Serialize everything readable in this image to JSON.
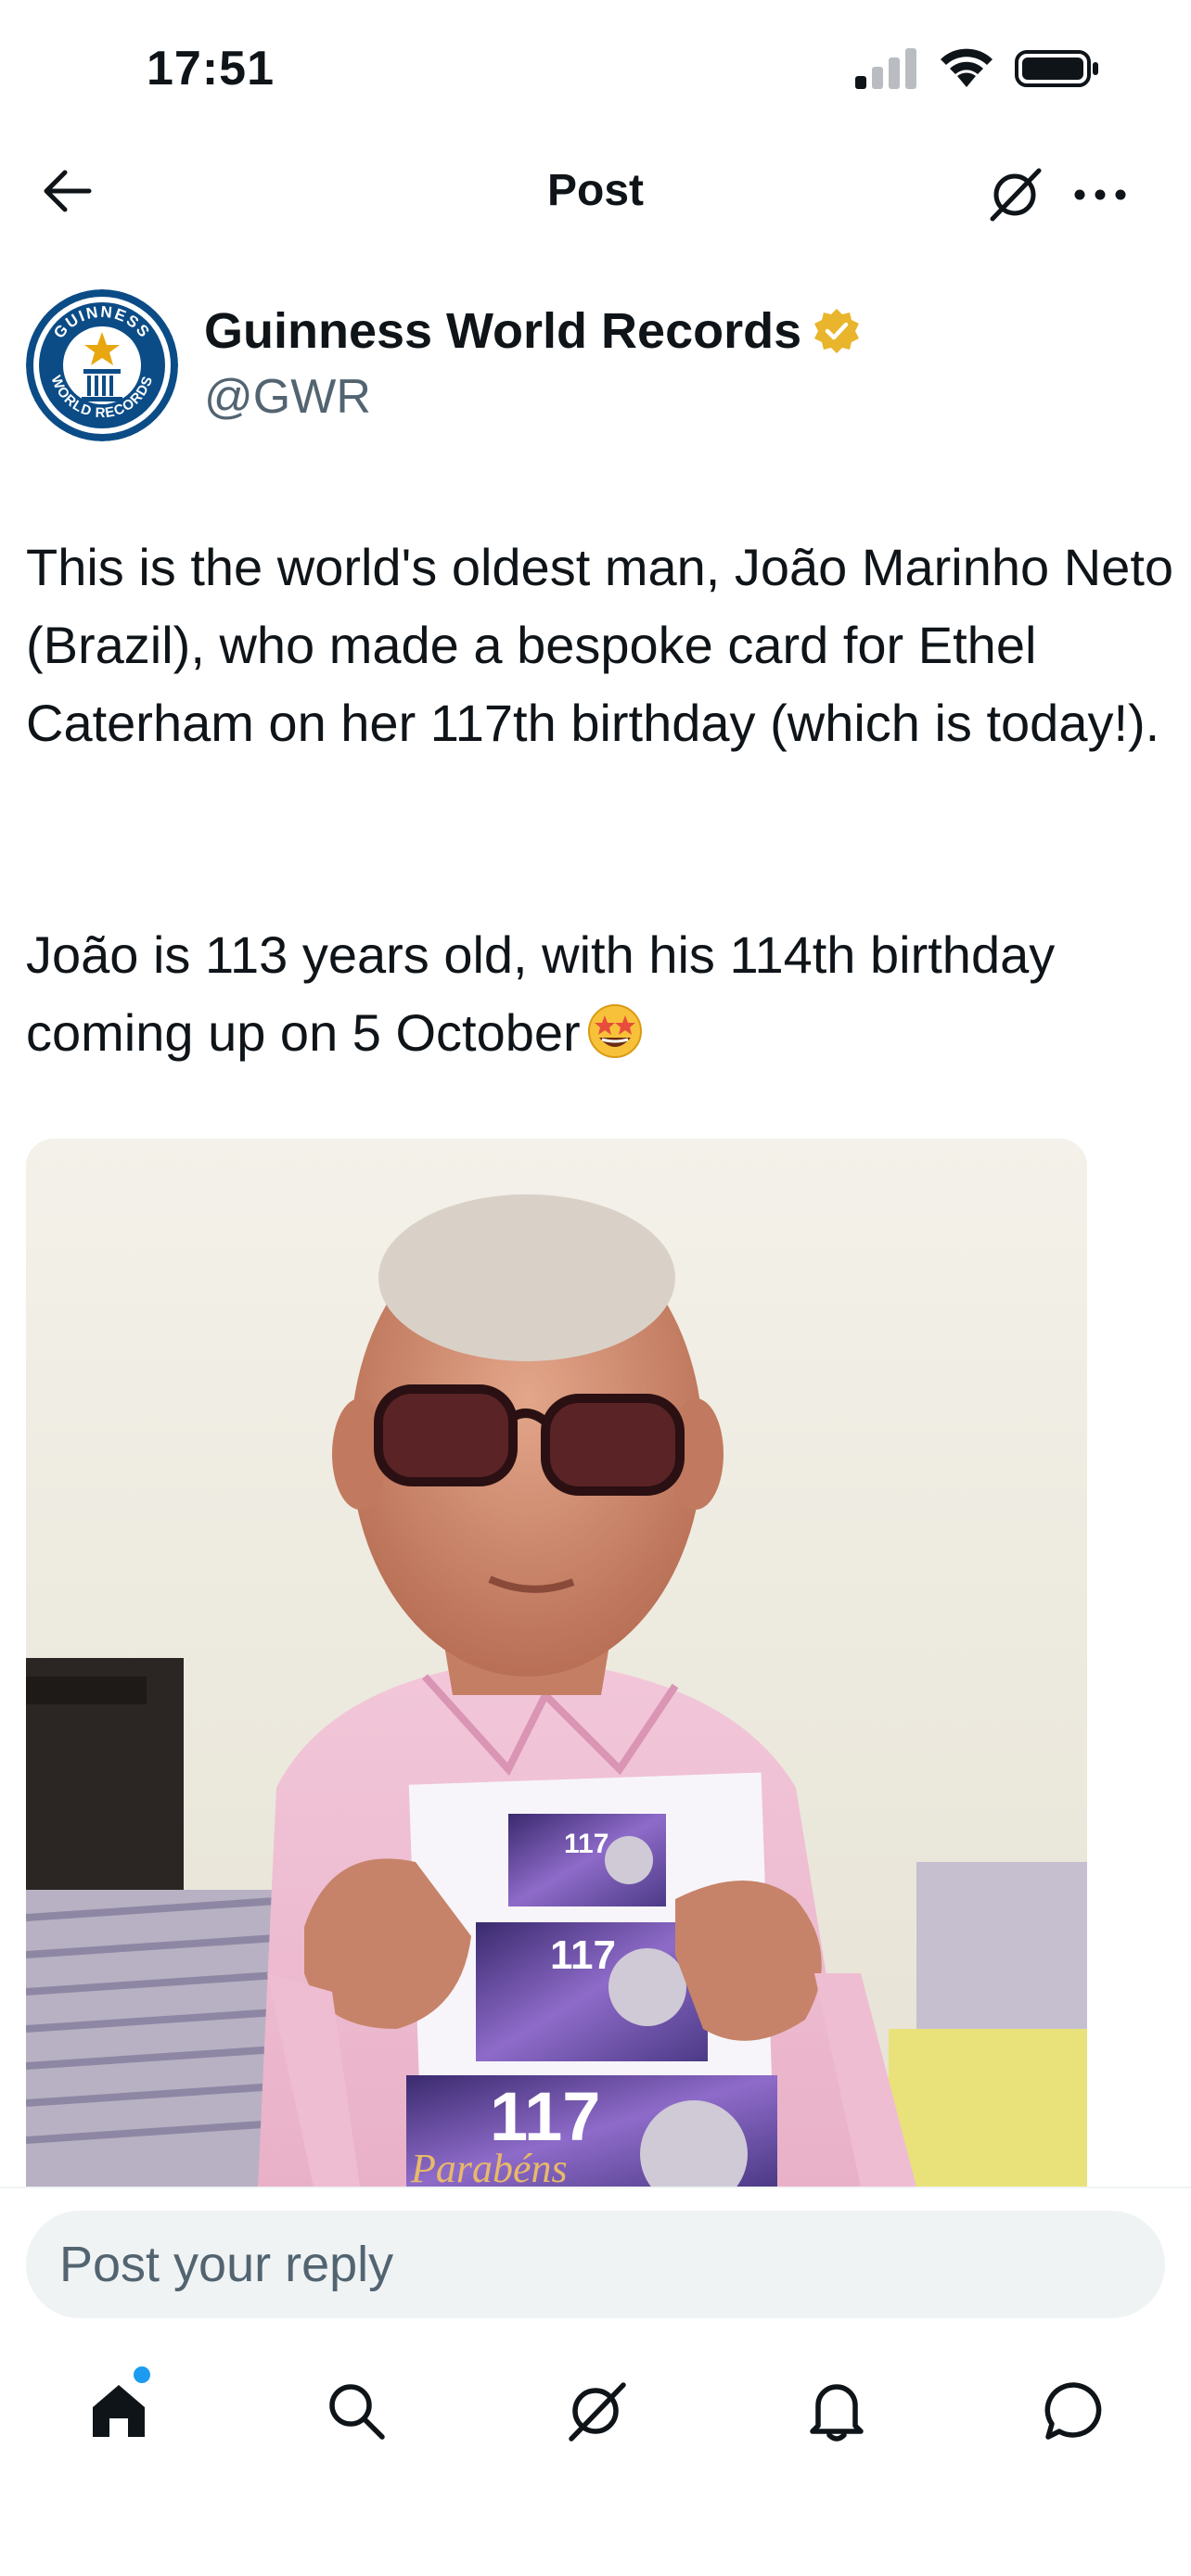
{
  "status_bar": {
    "time": "17:51"
  },
  "header": {
    "title": "Post"
  },
  "author": {
    "name": "Guinness World Records",
    "handle": "@GWR",
    "verified": true,
    "verified_color": "#e8b52c",
    "avatar_text_top": "GUINNESS",
    "avatar_text_bottom": "WORLD RECORDS"
  },
  "post": {
    "paragraph1": "This is the world's oldest man, João Marinho Neto (Brazil), who made a bespoke card for Ethel Caterham on her 117th birthday (which is today!).",
    "paragraph2": "João is 113 years old, with his 114th birthday coming up on 5 October",
    "emoji": "star-struck-emoji",
    "media": {
      "card_number": "117",
      "card_caption": "Parabéns"
    }
  },
  "reply": {
    "placeholder": "Post your reply"
  },
  "nav": {
    "items": [
      "home-icon",
      "search-icon",
      "grok-icon",
      "notifications-icon",
      "messages-icon"
    ],
    "active": "home-icon",
    "badge_color": "#1d9bf0"
  },
  "colors": {
    "text": "#0f1419",
    "secondary": "#536471",
    "input_bg": "#eff3f4"
  }
}
